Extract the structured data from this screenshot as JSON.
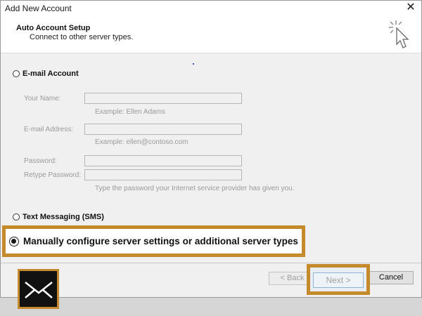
{
  "window": {
    "title": "Add New Account",
    "close_glyph": "✕"
  },
  "header": {
    "title": "Auto Account Setup",
    "subtitle": "Connect to other server types.",
    "icon": "wizard-cursor-icon"
  },
  "options": {
    "email_account": {
      "label": "E-mail Account",
      "selected": false
    },
    "text_messaging": {
      "label": "Text Messaging (SMS)",
      "selected": false
    },
    "manual": {
      "label": "Manually configure server settings or additional server types",
      "selected": true
    }
  },
  "form": {
    "your_name": {
      "label": "Your Name:",
      "value": "",
      "hint": "Example: Ellen Adams"
    },
    "email_address": {
      "label": "E-mail Address:",
      "value": "",
      "hint": "Example: ellen@contoso.com"
    },
    "password": {
      "label": "Password:",
      "value": ""
    },
    "retype_password": {
      "label": "Retype Password:",
      "value": ""
    },
    "password_hint": "Type the password your Internet service provider has given you."
  },
  "buttons": {
    "back": "< Back",
    "next": "Next >",
    "cancel": "Cancel"
  },
  "overlay": {
    "icon": "mail-envelope-icon",
    "accent": "#c48a2c"
  }
}
